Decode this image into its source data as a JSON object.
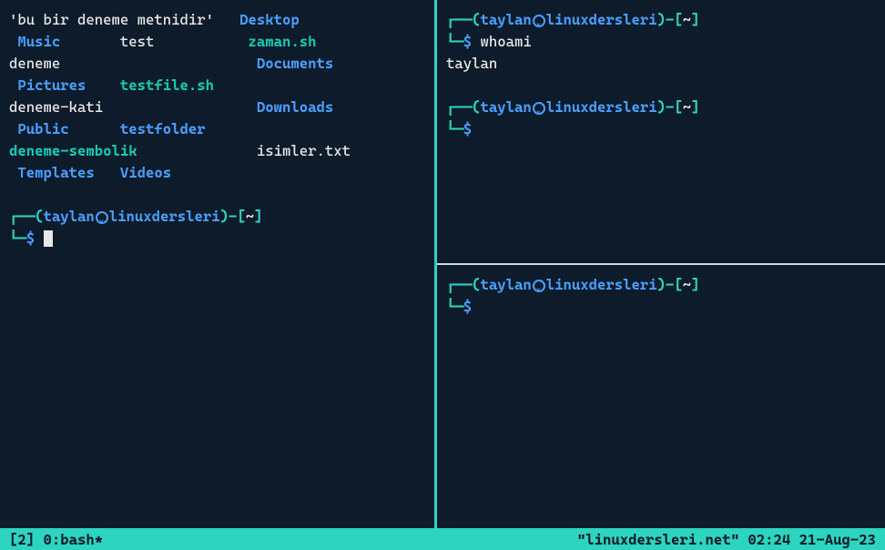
{
  "left_pane": {
    "ls_output": {
      "row0": {
        "c0": "'bu bir deneme metnidir'",
        "c1": "Desktop"
      },
      "row1": {
        "c0": "Music",
        "c1": "test",
        "c2": "zaman.sh"
      },
      "row2": {
        "c0": "deneme",
        "c1": "Documents"
      },
      "row3": {
        "c0": "Pictures",
        "c1": "testfile.sh"
      },
      "row4": {
        "c0": "deneme-kati",
        "c1": "Downloads"
      },
      "row5": {
        "c0": "Public",
        "c1": "testfolder"
      },
      "row6": {
        "c0": "deneme-sembolik",
        "c1": "isimler.txt"
      },
      "row7": {
        "c0": "Templates",
        "c1": "Videos"
      }
    },
    "prompt": {
      "user": "taylan",
      "host": "linuxdersleri",
      "path": "~",
      "symbol": "$"
    }
  },
  "right_top": {
    "prompt1": {
      "user": "taylan",
      "host": "linuxdersleri",
      "path": "~",
      "symbol": "$",
      "command": "whoami",
      "output": "taylan"
    },
    "prompt2": {
      "user": "taylan",
      "host": "linuxdersleri",
      "path": "~",
      "symbol": "$"
    }
  },
  "right_bottom": {
    "prompt": {
      "user": "taylan",
      "host": "linuxdersleri",
      "path": "~",
      "symbol": "$"
    }
  },
  "status": {
    "left": "[2] 0:bash*",
    "right": "\"linuxdersleri.net\" 02:24 21-Aug-23"
  }
}
